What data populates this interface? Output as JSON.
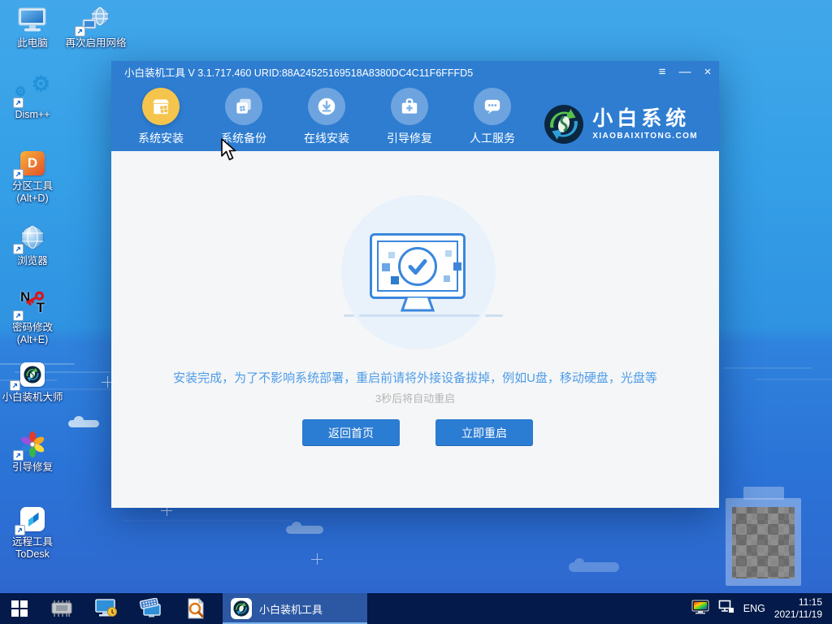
{
  "desktop": {
    "icons": [
      {
        "lines": [
          "此电脑"
        ]
      },
      {
        "lines": [
          "再次启用网络"
        ]
      },
      {
        "lines": [
          "Dism++"
        ]
      },
      {
        "lines": [
          "分区工具",
          "(Alt+D)"
        ]
      },
      {
        "lines": [
          "浏览器"
        ]
      },
      {
        "lines": [
          "密码修改",
          "(Alt+E)"
        ]
      },
      {
        "lines": [
          "小白装机大师"
        ]
      },
      {
        "lines": [
          "引导修复"
        ]
      },
      {
        "lines": [
          "远程工具",
          "ToDesk"
        ]
      }
    ]
  },
  "window": {
    "title": "小白装机工具 V 3.1.717.460 URID:88A24525169518A8380DC4C11F6FFFD5",
    "controls": {
      "menu": "≡",
      "minimize": "—",
      "close": "×"
    },
    "tabs": [
      {
        "label": "系统安装",
        "active": true
      },
      {
        "label": "系统备份",
        "active": false
      },
      {
        "label": "在线安装",
        "active": false
      },
      {
        "label": "引导修复",
        "active": false
      },
      {
        "label": "人工服务",
        "active": false
      }
    ],
    "logo": {
      "name": "小白系统",
      "domain": "XIAOBAIXITONG.COM"
    },
    "main": {
      "message": "安装完成，为了不影响系统部署，重启前请将外接设备拔掉，例如U盘，移动硬盘，光盘等",
      "countdown": "3秒后将自动重启",
      "back_button": "返回首页",
      "restart_button": "立即重启"
    }
  },
  "taskbar": {
    "active_task": "小白装机工具",
    "tray": {
      "language": "ENG",
      "time": "11:15",
      "date": "2021/11/19"
    }
  },
  "glyphs": {
    "gear_large": "⚙",
    "gear_small": "⚙",
    "partition_letter": "D",
    "pw_n": "N",
    "pw_t": "T"
  },
  "colors": {
    "accent": "#2e7dd1",
    "button": "#2b7cd3",
    "taskbar": "#031a4a",
    "tab_active": "#f5c44c"
  }
}
